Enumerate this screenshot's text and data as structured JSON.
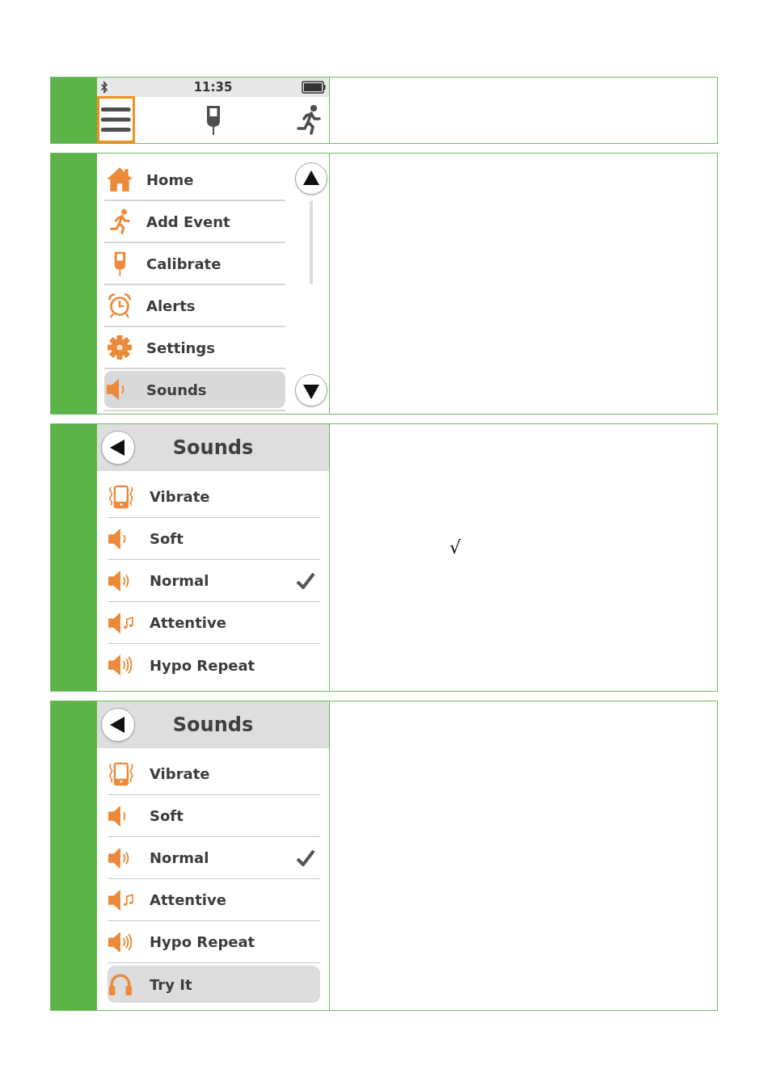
{
  "rows": [
    {
      "kind": "home",
      "status_bar": {
        "time": "11:35"
      },
      "toolbar": [
        {
          "kind": "menu",
          "selected": true
        },
        {
          "kind": "calibrate",
          "selected": false
        },
        {
          "kind": "event",
          "selected": false
        }
      ]
    },
    {
      "kind": "menu",
      "items": [
        {
          "kind": "home",
          "label": "Home",
          "selected": false
        },
        {
          "kind": "event",
          "label": "Add Event",
          "selected": false
        },
        {
          "kind": "calibrate",
          "label": "Calibrate",
          "selected": false
        },
        {
          "kind": "alerts",
          "label": "Alerts",
          "selected": false
        },
        {
          "kind": "settings",
          "label": "Settings",
          "selected": false
        },
        {
          "kind": "sounds",
          "label": "Sounds",
          "selected": true
        }
      ]
    },
    {
      "kind": "list",
      "title": "Sounds",
      "items": [
        {
          "kind": "vibrate",
          "label": "Vibrate",
          "selected": false,
          "checked": false
        },
        {
          "kind": "soft",
          "label": "Soft",
          "selected": false,
          "checked": false
        },
        {
          "kind": "normal",
          "label": "Normal",
          "selected": false,
          "checked": true
        },
        {
          "kind": "attentive",
          "label": "Attentive",
          "selected": false,
          "checked": false
        },
        {
          "kind": "hypo",
          "label": "Hypo Repeat",
          "selected": false,
          "checked": false
        }
      ],
      "note": "√"
    },
    {
      "kind": "list",
      "title": "Sounds",
      "items": [
        {
          "kind": "vibrate",
          "label": "Vibrate",
          "selected": false,
          "checked": false
        },
        {
          "kind": "soft",
          "label": "Soft",
          "selected": false,
          "checked": false
        },
        {
          "kind": "normal",
          "label": "Normal",
          "selected": false,
          "checked": true
        },
        {
          "kind": "attentive",
          "label": "Attentive",
          "selected": false,
          "checked": false
        },
        {
          "kind": "hypo",
          "label": "Hypo Repeat",
          "selected": false,
          "checked": false
        },
        {
          "kind": "try",
          "label": "Try It",
          "selected": true,
          "checked": false
        }
      ]
    }
  ]
}
